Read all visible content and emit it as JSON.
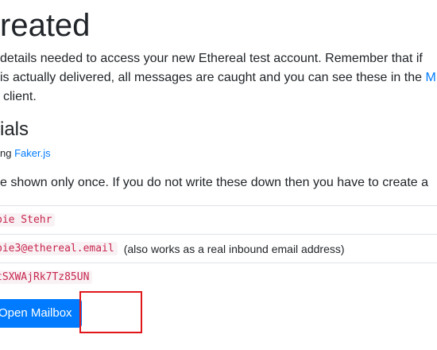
{
  "heading": "reated",
  "intro": {
    "line1": "details needed to access your new Ethereal test account. Remember that if",
    "line2_before": "is actually delivered, all messages are caught and you can see these in the ",
    "line2_link": "M",
    "line3": "client."
  },
  "credentials_heading": "ials",
  "generated": {
    "prefix": "ng ",
    "link": "Faker.js"
  },
  "warning": "e shown only once. If you do not write these down then you have to create a",
  "fields": {
    "name": "bie Stehr",
    "username": "bie3@ethereal.email",
    "username_note": "(also works as a real inbound email address)",
    "password": "tSXWAjRk7Tz85UN"
  },
  "open_mailbox_label": "Open Mailbox"
}
